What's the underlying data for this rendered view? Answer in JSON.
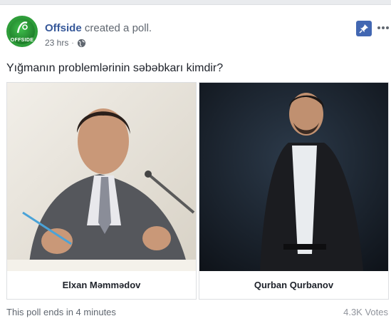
{
  "post": {
    "page_name": "Offside",
    "action_text": "created a poll.",
    "time": "23 hrs",
    "separator": "·",
    "avatar_logo_text": "OFFSIDE",
    "question": "Yığmanın problemlərinin səbəbkarı kimdir?"
  },
  "poll": {
    "options": [
      {
        "label": "Elxan Məmmədov"
      },
      {
        "label": "Qurban Qurbanov"
      }
    ],
    "ends_text": "This poll ends in 4 minutes",
    "votes_text": "4.3K Votes"
  },
  "icons": {
    "globe": "globe-icon",
    "pin": "pin-icon",
    "more": "more-options-icon"
  },
  "colors": {
    "link": "#365899",
    "pin_bg": "#4267b2",
    "avatar_bg": "#2e9d3a",
    "meta_text": "#606770"
  }
}
